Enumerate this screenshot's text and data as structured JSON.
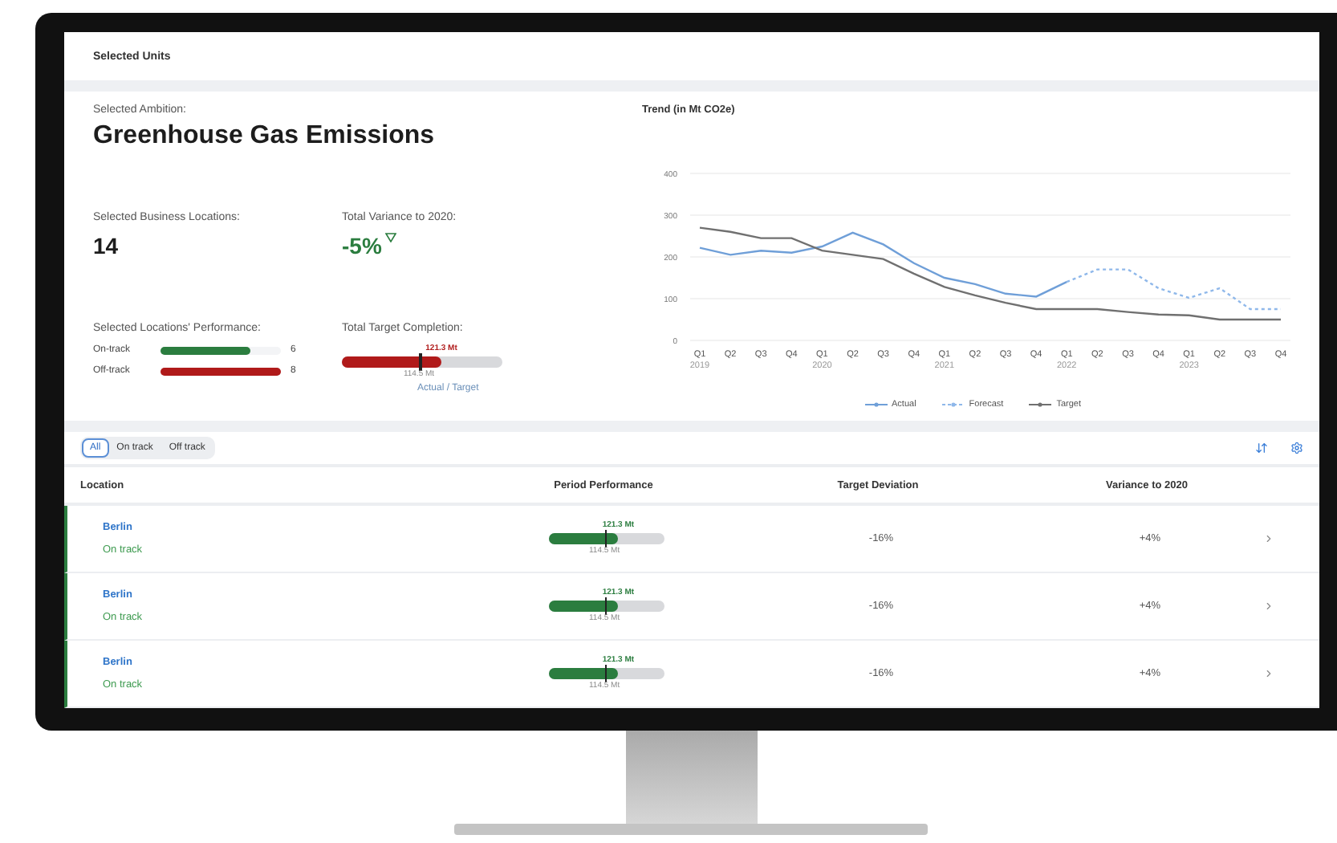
{
  "header": {
    "title": "Selected Units"
  },
  "ambition": {
    "label": "Selected Ambition:",
    "title": "Greenhouse Gas Emissions"
  },
  "kpis": [
    {
      "label": "Selected Business Locations:",
      "value": "14",
      "down_indicator": false
    },
    {
      "label": "Total Variance to 2020:",
      "value": "-5%",
      "down_indicator": true
    }
  ],
  "performance": {
    "label": "Selected Locations' Performance:",
    "bars": [
      {
        "name": "On-track",
        "count": "6",
        "level": 0.75,
        "on_track": true
      },
      {
        "name": "Off-track",
        "count": "8",
        "level": 1,
        "on_track": false
      }
    ]
  },
  "completion": {
    "label": "Total Target Completion:",
    "actual": "121.3 Mt",
    "target": "114.5 Mt",
    "caption": "Actual / Target",
    "level": 0.62,
    "on_track": false
  },
  "chart": {
    "title": "Trend (in Mt CO2e)",
    "chart_data": {
      "type": "line",
      "grid": true,
      "legend": true,
      "categories": [
        "Q1 2019",
        "Q2",
        "Q3",
        "Q4",
        "Q1 2020",
        "Q2",
        "Q3",
        "Q4",
        "Q1 2021",
        "Q2",
        "Q3",
        "Q4",
        "Q1 2022",
        "Q2",
        "Q3",
        "Q4",
        "Q1 2023",
        "Q2",
        "Q3",
        "Q4"
      ],
      "ylim": [
        0,
        400
      ],
      "yticks": [
        0,
        100,
        200,
        300,
        400
      ],
      "series": [
        {
          "name": "Actual",
          "color": "#6f9fd8",
          "line_style": "solid",
          "values": [
            222,
            205,
            215,
            210,
            225,
            258,
            230,
            185,
            150,
            135,
            112,
            105,
            140,
            null,
            null,
            null,
            null,
            null,
            null,
            null
          ]
        },
        {
          "name": "Forecast",
          "color": "#8fb8ea",
          "line_style": "dashed",
          "values": [
            null,
            null,
            null,
            null,
            null,
            null,
            null,
            null,
            null,
            null,
            null,
            null,
            140,
            170,
            170,
            125,
            102,
            125,
            75,
            75
          ]
        },
        {
          "name": "Target",
          "color": "#707070",
          "line_style": "solid",
          "values": [
            270,
            260,
            245,
            245,
            215,
            205,
            195,
            160,
            128,
            108,
            90,
            75,
            75,
            75,
            68,
            62,
            60,
            50,
            50,
            50
          ]
        }
      ]
    }
  },
  "filters": [
    {
      "label": "All",
      "selected": true
    },
    {
      "label": "On track",
      "selected": false
    },
    {
      "label": "Off track",
      "selected": false
    }
  ],
  "table": {
    "columns": [
      "Location",
      "Period Performance",
      "Target Deviation",
      "Variance to 2020"
    ],
    "rows": [
      {
        "location": "Berlin",
        "status": "On track",
        "on_track": true,
        "actual": "121.3 Mt",
        "target": "114.5 Mt",
        "level": 0.6,
        "deviation": "-16%",
        "variance": "+4%"
      },
      {
        "location": "Berlin",
        "status": "On track",
        "on_track": true,
        "actual": "121.3 Mt",
        "target": "114.5 Mt",
        "level": 0.6,
        "deviation": "-16%",
        "variance": "+4%"
      },
      {
        "location": "Berlin",
        "status": "On track",
        "on_track": true,
        "actual": "121.3 Mt",
        "target": "114.5 Mt",
        "level": 0.6,
        "deviation": "-16%",
        "variance": "+4%"
      }
    ]
  }
}
